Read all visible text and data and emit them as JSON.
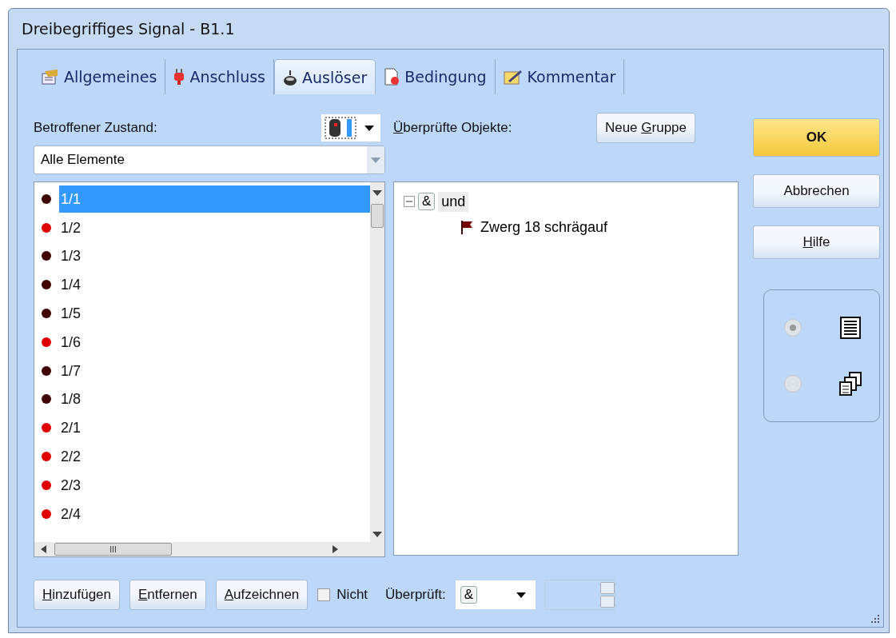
{
  "window": {
    "title": "Dreibegriffiges Signal - B1.1"
  },
  "tabs": [
    {
      "label": "Allgemeines",
      "selected": false
    },
    {
      "label": "Anschluss",
      "selected": false
    },
    {
      "label": "Auslöser",
      "selected": true
    },
    {
      "label": "Bedingung",
      "selected": false
    },
    {
      "label": "Kommentar",
      "selected": false
    }
  ],
  "state_label": "Betroffener Zustand:",
  "filter": {
    "value": "Alle Elemente"
  },
  "elements": [
    {
      "label": "1/1",
      "color": "#400000",
      "selected": true
    },
    {
      "label": "1/2",
      "color": "#e00000",
      "selected": false
    },
    {
      "label": "1/3",
      "color": "#400000",
      "selected": false
    },
    {
      "label": "1/4",
      "color": "#400000",
      "selected": false
    },
    {
      "label": "1/5",
      "color": "#400000",
      "selected": false
    },
    {
      "label": "1/6",
      "color": "#e00000",
      "selected": false
    },
    {
      "label": "1/7",
      "color": "#400000",
      "selected": false
    },
    {
      "label": "1/8",
      "color": "#400000",
      "selected": false
    },
    {
      "label": "2/1",
      "color": "#e00000",
      "selected": false
    },
    {
      "label": "2/2",
      "color": "#e00000",
      "selected": false
    },
    {
      "label": "2/3",
      "color": "#e00000",
      "selected": false
    },
    {
      "label": "2/4",
      "color": "#e00000",
      "selected": false
    }
  ],
  "scroll_mark": "III",
  "checked_label": {
    "key": "Ü",
    "after": "berprüfte Objekte:"
  },
  "new_group_button": {
    "before": "Neue ",
    "key": "G",
    "after": "ruppe"
  },
  "tree": [
    {
      "operator": "&",
      "label": "und",
      "expanded": true,
      "children": [
        {
          "label": "Zwerg 18 schrägauf"
        }
      ]
    }
  ],
  "actions": [
    {
      "key": "H",
      "after": "inzufügen"
    },
    {
      "key": "E",
      "after": "ntfernen"
    },
    {
      "key": "A",
      "after": "ufzeichnen"
    }
  ],
  "not_checkbox": {
    "label": "Nicht",
    "checked": false
  },
  "checked_by": {
    "label": "Überprüft:",
    "value": "&"
  },
  "side_buttons": [
    {
      "after": "OK",
      "default": true
    },
    {
      "after": "Abbrechen",
      "default": false
    },
    {
      "key": "H",
      "after": "ilfe",
      "default": false
    }
  ],
  "view_options": [
    {
      "selected": true
    },
    {
      "selected": false
    }
  ]
}
